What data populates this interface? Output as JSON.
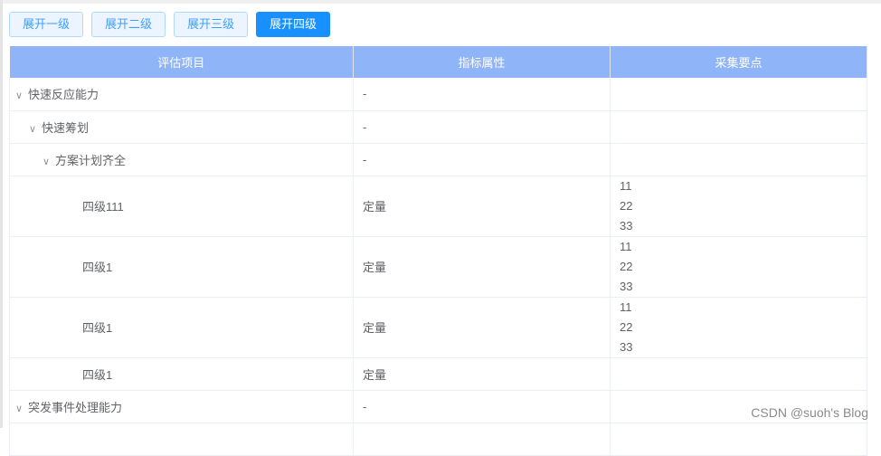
{
  "buttons": [
    "展开一级",
    "展开二级",
    "展开三级",
    "展开四级"
  ],
  "columns": [
    "评估项目",
    "指标属性",
    "采集要点"
  ],
  "rows": [
    {
      "name": "快速反应能力",
      "level": 0,
      "expand": true,
      "attr": "-",
      "points": []
    },
    {
      "name": "快速筹划",
      "level": 1,
      "expand": true,
      "attr": "-",
      "points": []
    },
    {
      "name": "方案计划齐全",
      "level": 2,
      "expand": true,
      "attr": "-",
      "points": []
    },
    {
      "name": "四级111",
      "level": 3,
      "expand": false,
      "attr": "定量",
      "points": [
        "11",
        "22",
        "33"
      ]
    },
    {
      "name": "四级1",
      "level": 3,
      "expand": false,
      "attr": "定量",
      "points": [
        "11",
        "22",
        "33"
      ]
    },
    {
      "name": "四级1",
      "level": 3,
      "expand": false,
      "attr": "定量",
      "points": [
        "11",
        "22",
        "33"
      ]
    },
    {
      "name": "四级1",
      "level": 3,
      "expand": false,
      "attr": "定量",
      "points": []
    },
    {
      "name": "突发事件处理能力",
      "level": 0,
      "expand": true,
      "attr": "-",
      "points": []
    },
    {
      "name": "",
      "level": 0,
      "expand": false,
      "attr": "",
      "points": []
    }
  ],
  "watermark": "CSDN @suoh's Blog"
}
